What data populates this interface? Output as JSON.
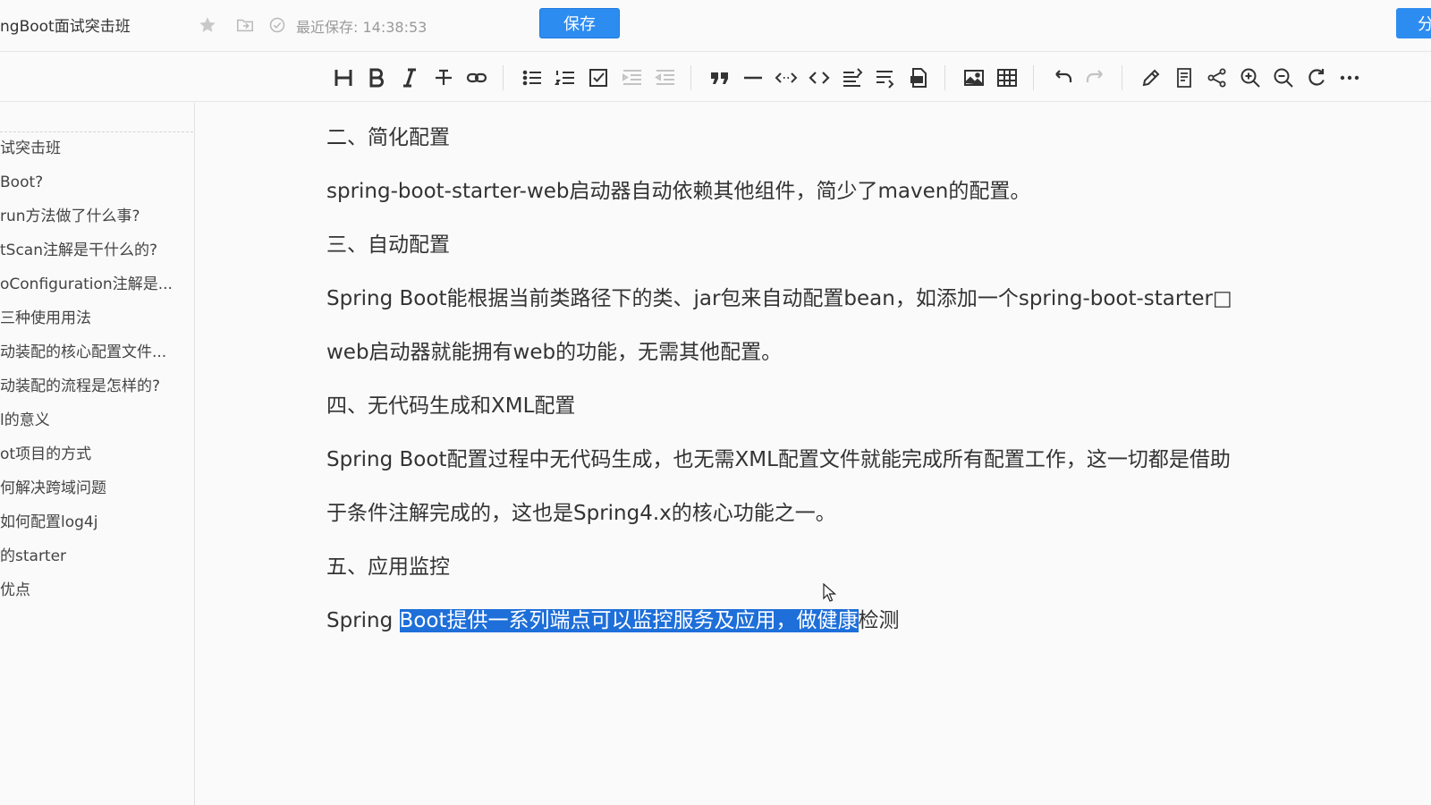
{
  "header": {
    "doc_title": "ngBoot面试突击班",
    "save_status": "最近保存: 14:38:53",
    "save_label": "保存",
    "share_label": "分"
  },
  "sidebar": {
    "items": [
      {
        "label": "试突击班"
      },
      {
        "label": "Boot?"
      },
      {
        "label": "run方法做了什么事?"
      },
      {
        "label": "tScan注解是干什么的?"
      },
      {
        "label": "oConfiguration注解是..."
      },
      {
        "label": "三种使用用法"
      },
      {
        "label": "动装配的核心配置文件..."
      },
      {
        "label": "动装配的流程是怎样的?"
      },
      {
        "label": "l的意义"
      },
      {
        "label": "ot项目的方式"
      },
      {
        "label": "何解决跨域问题"
      },
      {
        "label": "如何配置log4j"
      },
      {
        "label": "的starter"
      },
      {
        "label": "优点"
      }
    ]
  },
  "editor": {
    "paragraphs": [
      {
        "text": "二、简化配置"
      },
      {
        "text": "spring-boot-starter-web启动器自动依赖其他组件，简少了maven的配置。"
      },
      {
        "text": "三、自动配置"
      },
      {
        "text": "Spring Boot能根据当前类路径下的类、jar包来自动配置bean，如添加一个spring-boot-starter□"
      },
      {
        "text": "web启动器就能拥有web的功能，无需其他配置。"
      },
      {
        "text": "四、无代码生成和XML配置"
      },
      {
        "text": "Spring Boot配置过程中无代码生成，也无需XML配置文件就能完成所有配置工作，这一切都是借助"
      },
      {
        "text": "于条件注解完成的，这也是Spring4.x的核心功能之一。"
      },
      {
        "text": "五、应用监控"
      }
    ],
    "last_line": {
      "before": "Spring ",
      "selected": "Boot提供一系列端点可以监控服务及应用，做健康",
      "after": "检测"
    }
  },
  "colors": {
    "accent": "#2d8cf0",
    "selection": "#1e6fd9",
    "text": "#333333",
    "muted": "#9a9a9a"
  },
  "toolbar_icons": [
    "heading-icon",
    "bold-icon",
    "italic-icon",
    "strikethrough-icon",
    "link-icon",
    "bullet-list-icon",
    "ordered-list-icon",
    "checklist-icon",
    "indent-icon",
    "outdent-icon",
    "quote-icon",
    "horizontal-rule-icon",
    "inline-code-icon",
    "code-block-icon",
    "text-align-icon",
    "text-wrap-icon",
    "export-icon",
    "image-icon",
    "table-icon",
    "undo-icon",
    "redo-icon",
    "edit-icon",
    "preview-icon",
    "share-icon",
    "zoom-in-icon",
    "zoom-out-icon",
    "refresh-icon",
    "more-icon"
  ]
}
